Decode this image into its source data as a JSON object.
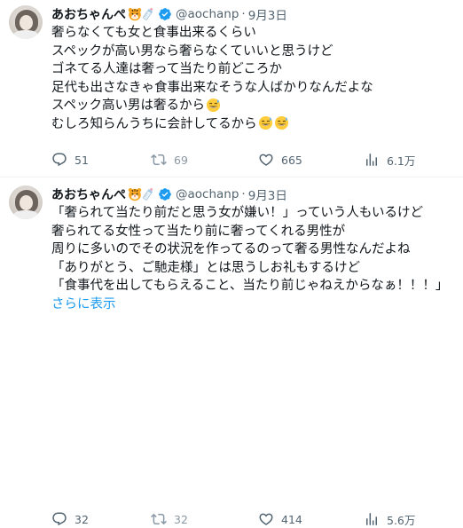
{
  "tweets": [
    {
      "author": {
        "name": "あおちゃんぺ",
        "handle": "@aochanp",
        "separator": "·",
        "date": "9月3日"
      },
      "lines": [
        "奢らなくても女と食事出来るくらい",
        "スペックが高い男なら奢らなくていいと思うけど",
        "ゴネてる人達は奢って当たり前どころか",
        "足代も出さなきゃ食事出来なそうな人ばかりなんだよな",
        "スペック高い男は奢るから",
        "むしろ知らんうちに会計してるから"
      ],
      "show_more": "",
      "stats": {
        "replies": "51",
        "retweets": "69",
        "likes": "665",
        "views": "6.1万"
      }
    },
    {
      "author": {
        "name": "あおちゃんぺ",
        "handle": "@aochanp",
        "separator": "·",
        "date": "9月3日"
      },
      "lines": [
        "「奢られて当たり前だと思う女が嫌い！」っていう人もいるけど",
        "奢られてる女性って当たり前に奢ってくれる男性が",
        "周りに多いのでその状況を作ってるのって奢る男性なんだよね",
        "「ありがとう、ご馳走様」とは思うしお礼もするけど",
        "「食事代を出してもらえること、当たり前じゃねえからなぁ！！！」"
      ],
      "show_more": "さらに表示",
      "stats": {
        "replies": "32",
        "retweets": "32",
        "likes": "414",
        "views": "5.6万"
      }
    }
  ],
  "icons": {
    "name_emojis": [
      "tiger-face-emoji",
      "baby-bottle-emoji"
    ],
    "verified": "verified-badge-icon",
    "line_emoji": "grinning-sweat-emoji",
    "actions": [
      "reply-icon",
      "retweet-icon",
      "like-icon",
      "views-icon"
    ]
  },
  "colors": {
    "text": "#0f1419",
    "secondary": "#536471",
    "accent": "#1d9bf0",
    "retweet_count": "#8b98a5"
  }
}
